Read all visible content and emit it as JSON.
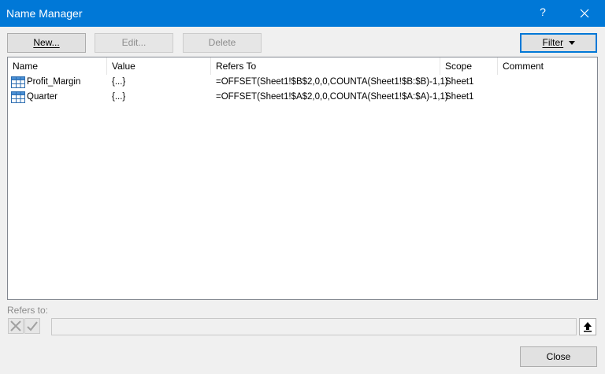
{
  "window": {
    "title": "Name Manager",
    "help_glyph": "?"
  },
  "toolbar": {
    "new_label": "New...",
    "edit_label": "Edit...",
    "delete_label": "Delete",
    "filter_label": "Filter"
  },
  "table": {
    "columns": [
      "Name",
      "Value",
      "Refers To",
      "Scope",
      "Comment"
    ],
    "rows": [
      {
        "name": "Profit_Margin",
        "value": "{...}",
        "refers_to": "=OFFSET(Sheet1!$B$2,0,0,COUNTA(Sheet1!$B:$B)-1,1)",
        "scope": "Sheet1",
        "comment": "",
        "icon": "named-range-icon"
      },
      {
        "name": "Quarter",
        "value": "{...}",
        "refers_to": "=OFFSET(Sheet1!$A$2,0,0,COUNTA(Sheet1!$A:$A)-1,1)",
        "scope": "Sheet1",
        "comment": "",
        "icon": "named-range-icon"
      }
    ]
  },
  "refers_to": {
    "label": "Refers to:",
    "value": ""
  },
  "footer": {
    "close_label": "Close"
  },
  "colors": {
    "titlebar": "#0078d7",
    "focus_border": "#0078d7"
  }
}
